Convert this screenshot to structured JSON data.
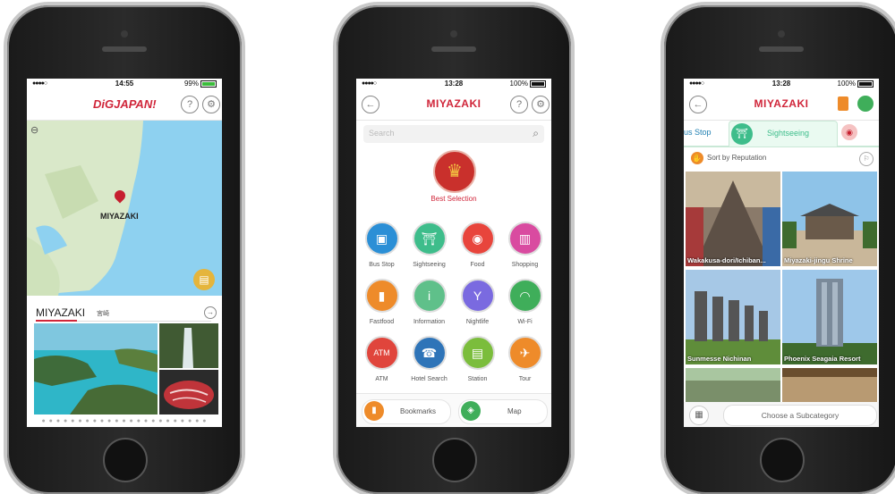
{
  "phone1": {
    "status": {
      "signal": "●●●●○",
      "time": "14:55",
      "battery": "99%"
    },
    "logo": "DiGJAPAN!",
    "help_label": "?",
    "map": {
      "pin_label": "MIYAZAKI"
    },
    "city": {
      "name": "MIYAZAKI",
      "jp": "宮崎"
    },
    "page_dots": "● ● ● ● ● ● ● ● ● ● ● ● ● ● ● ● ● ● ● ● ● ● ●"
  },
  "phone2": {
    "status": {
      "signal": "●●●●○",
      "time": "13:28",
      "battery": "100%"
    },
    "title": "MIYAZAKI",
    "help_label": "?",
    "search_placeholder": "Search",
    "best_selection": "Best Selection",
    "categories": [
      {
        "label": "Bus Stop",
        "color": "#2b8fd6"
      },
      {
        "label": "Sightseeing",
        "color": "#3ebd8b"
      },
      {
        "label": "Food",
        "color": "#e8453c"
      },
      {
        "label": "Shopping",
        "color": "#d94ba0"
      },
      {
        "label": "Fastfood",
        "color": "#ee8b2a"
      },
      {
        "label": "Information",
        "color": "#5fc08a"
      },
      {
        "label": "Nightlife",
        "color": "#7a6ae0"
      },
      {
        "label": "Wi-Fi",
        "color": "#3fae5a"
      },
      {
        "label": "ATM",
        "color": "#e0453c"
      },
      {
        "label": "Hotel Search",
        "color": "#2e74b8"
      },
      {
        "label": "Station",
        "color": "#7bbd3c"
      },
      {
        "label": "Tour",
        "color": "#ee8b2a"
      }
    ],
    "bookmarks": "Bookmarks",
    "map": "Map"
  },
  "phone3": {
    "status": {
      "signal": "●●●●○",
      "time": "13:28",
      "battery": "100%"
    },
    "title": "MIYAZAKI",
    "tab_left": "us Stop",
    "tab_active": "Sightseeing",
    "sort_label": "Sort by Reputation",
    "tiles": [
      "Wakakusa-dori/Ichiban...",
      "Miyazaki-jingu Shrine",
      "Sunmesse Nichinan",
      "Phoenix Seagaia Resort"
    ],
    "subcategory": "Choose a Subcategory"
  }
}
